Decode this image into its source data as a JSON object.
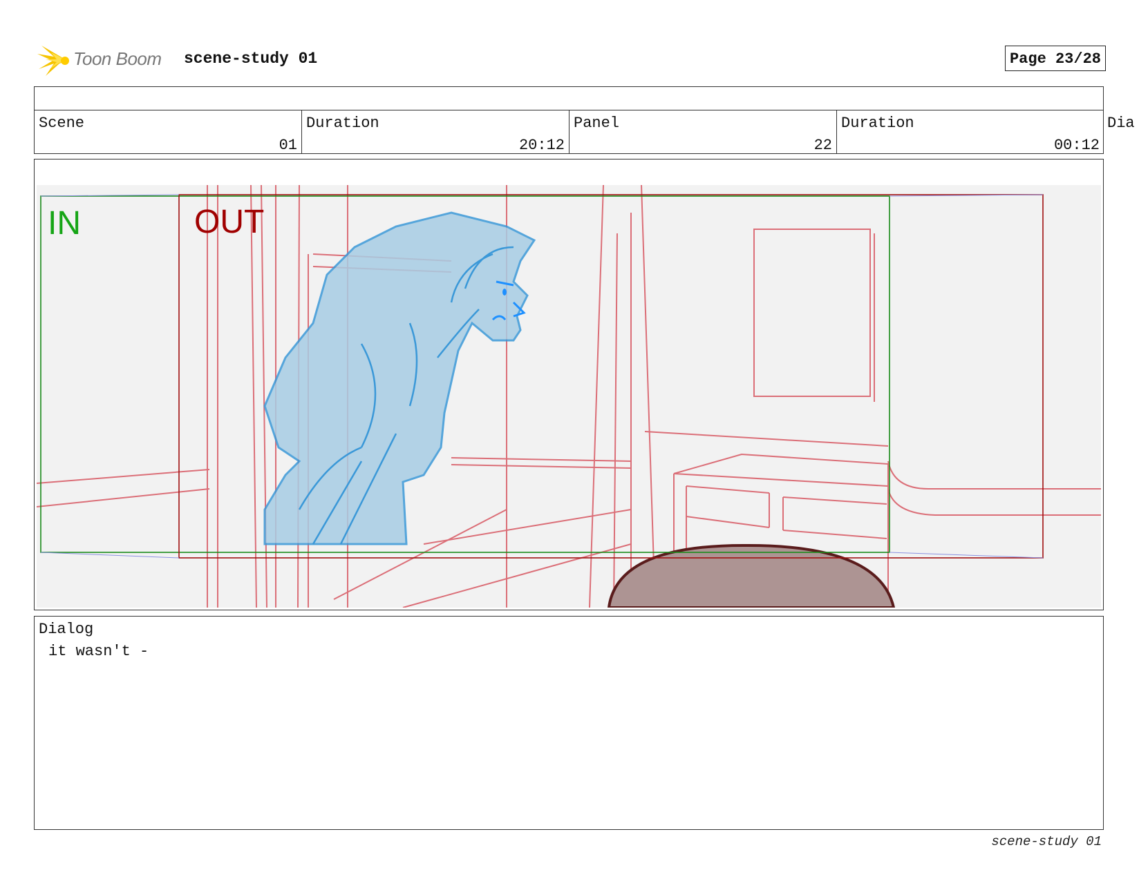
{
  "header": {
    "logo_text": "Toon Boom",
    "project_title": "scene-study 01",
    "page_label": "Page 23/28"
  },
  "info": {
    "scene_label": "Scene",
    "scene_value": "01",
    "duration_label": "Duration",
    "scene_duration": "20:12",
    "panel_label": "Panel",
    "panel_value": "22",
    "panel_duration_label": "Duration",
    "panel_duration": "00:12",
    "extra_label": "Dia"
  },
  "panel": {
    "in_label": "IN",
    "out_label": "OUT",
    "colors": {
      "in_frame": "#1a8a1a",
      "out_frame": "#a01010",
      "layout_lines": "#d9606a",
      "character": "#3a98d8"
    }
  },
  "dialog": {
    "label": "Dialog",
    "text": "it wasn't -"
  },
  "footer": {
    "text": "scene-study 01"
  }
}
